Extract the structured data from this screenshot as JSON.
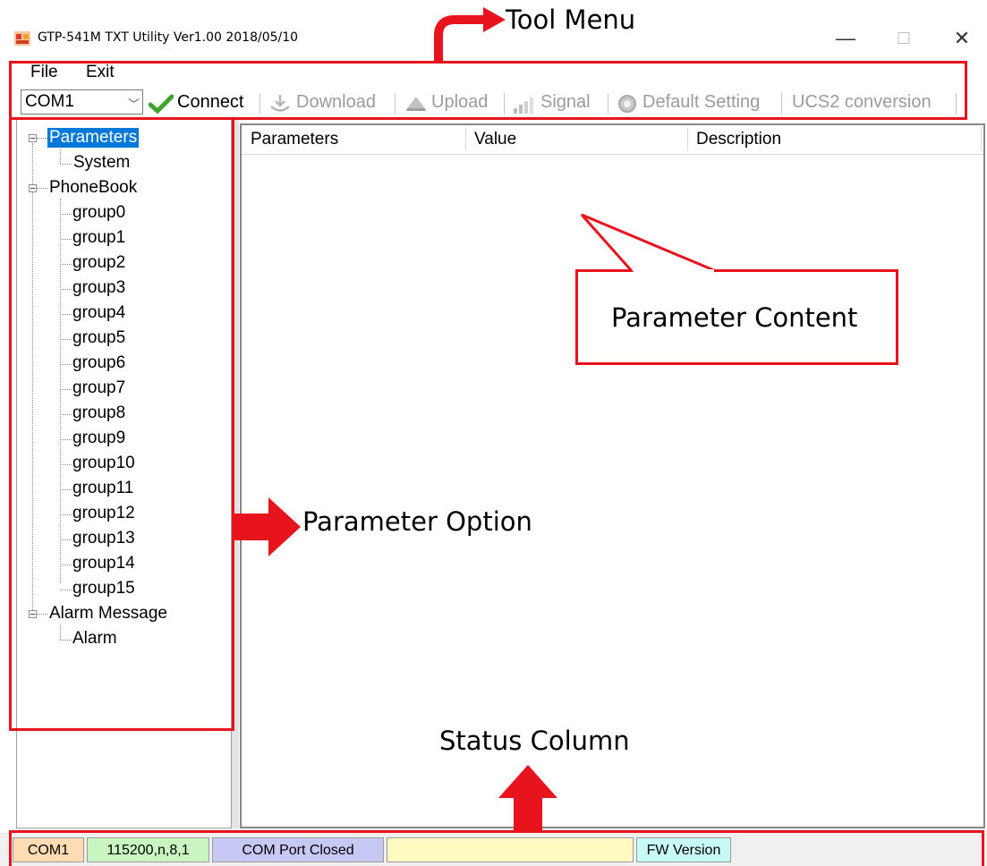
{
  "window": {
    "title": "GTP-541M TXT Utility Ver1.00 2018/05/10",
    "minimize_glyph": "—",
    "maximize_glyph": "☐",
    "close_glyph": "✕"
  },
  "menu": {
    "items": [
      {
        "label": "File"
      },
      {
        "label": "Exit"
      }
    ]
  },
  "toolbar": {
    "port_value": "COM1",
    "connect": "Connect",
    "download": "Download",
    "upload": "Upload",
    "signal": "Signal",
    "default_setting": "Default Setting",
    "ucs2": "UCS2 conversion"
  },
  "tree": {
    "parameters": "Parameters",
    "system": "System",
    "phonebook": "PhoneBook",
    "groups": [
      "group0",
      "group1",
      "group2",
      "group3",
      "group4",
      "group5",
      "group6",
      "group7",
      "group8",
      "group9",
      "group10",
      "group11",
      "group12",
      "group13",
      "group14",
      "group15"
    ],
    "alarm_message": "Alarm Message",
    "alarm": "Alarm"
  },
  "list": {
    "columns": [
      "Parameters",
      "Value",
      "Description"
    ]
  },
  "status": {
    "port": "COM1",
    "baud": "115200,n,8,1",
    "state": "COM Port Closed",
    "message": "",
    "fw": "FW Version"
  },
  "annotations": {
    "tool_menu": "Tool Menu",
    "parameter_content": "Parameter Content",
    "parameter_option": "Parameter Option",
    "status_column": "Status Column"
  },
  "colors": {
    "annotation_red": "#e8141d",
    "selection_blue": "#0078d7",
    "status_port_bg": "#ffdcb4",
    "status_baud_bg": "#c8f5c0",
    "status_state_bg": "#c8c8f5",
    "status_msg_bg": "#fffac0",
    "status_fw_bg": "#c8faf5"
  }
}
